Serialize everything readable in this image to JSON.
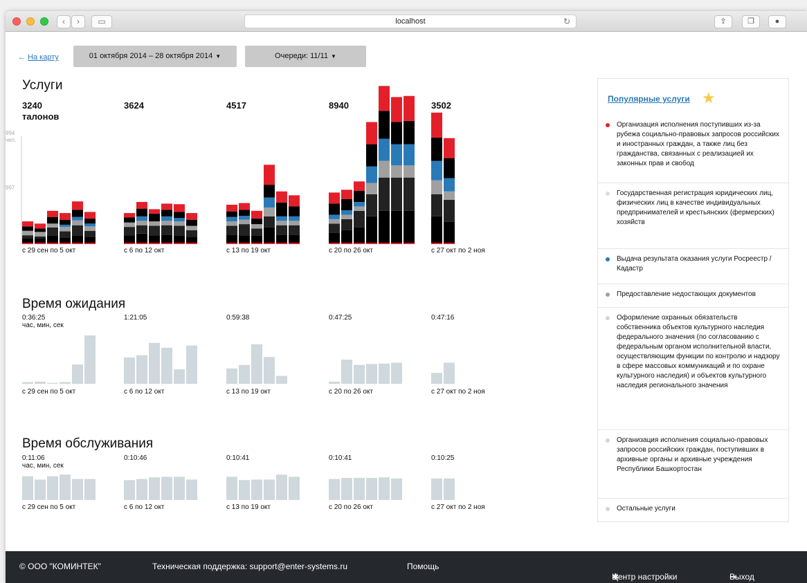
{
  "browser": {
    "url": "localhost"
  },
  "nav": {
    "back_label": "На карту",
    "date_range_label": "01 октября 2014 – 28 октября 2014",
    "queues_label": "Очереди: 11/11"
  },
  "services": {
    "title": "Услуги",
    "unit": "талонов",
    "axis_max_label": "994",
    "axis_unit_label": "чел.",
    "axis_mid_label": "997",
    "weeks": [
      {
        "label": "с 29 сен по 5 окт",
        "total": "3240"
      },
      {
        "label": "с 6 по 12 окт",
        "total": "3624"
      },
      {
        "label": "с 13 по 19 окт",
        "total": "4517"
      },
      {
        "label": "с 20 по 26 окт",
        "total": "8940"
      },
      {
        "label": "с 27 окт по 2 ноя",
        "total": "3502"
      }
    ]
  },
  "wait": {
    "title": "Время ожидания",
    "unit": "час, мин, сек",
    "weeks": [
      {
        "label": "с 29 сен по 5 окт",
        "value": "0:36:25"
      },
      {
        "label": "с 6 по 12 окт",
        "value": "1:21:05"
      },
      {
        "label": "с 13 по 19 окт",
        "value": "0:59:38"
      },
      {
        "label": "с 20 по 26 окт",
        "value": "0:47:25"
      },
      {
        "label": "с 27 окт по 2 ноя",
        "value": "0:47:16"
      }
    ]
  },
  "service_time": {
    "title": "Время обслуживания",
    "unit": "час, мин, сек",
    "weeks": [
      {
        "label": "с 29 сен по 5 окт",
        "value": "0:11:06"
      },
      {
        "label": "с 6 по 12 окт",
        "value": "0:10:46"
      },
      {
        "label": "с 13 по 19 окт",
        "value": "0:10:41"
      },
      {
        "label": "с 20 по 26 окт",
        "value": "0:10:41"
      },
      {
        "label": "с 27 окт по 2 ноя",
        "value": "0:10:25"
      }
    ]
  },
  "popular": {
    "title": "Популярные услуги",
    "items": [
      {
        "label": "Организация исполнения поступивших из-за рубежа социально-правовых запросов российских и иностранных граждан, а также лиц без гражданства, связанных с реализацией их законных прав и свобод",
        "color": "#e3202a"
      },
      {
        "label": "Государственная регистрация юридических лиц, физических лиц в качестве индивидуальных предпринимателей и крестьянских (фермерских) хозяйств",
        "color": "#d9dde0"
      },
      {
        "label": "Выдача результата оказания услуги Росреестр / Кадастр",
        "color": "#2a7ab8"
      },
      {
        "label": "Предоставление недостающих документов",
        "color": "#a0a0a0"
      },
      {
        "label": "Оформление охранных обязательств собственника объектов культурного наследия федерального значения (по согласованию с федеральным органом исполнительной власти, осуществляющим функции по контролю и надзору в сфере массовых коммуникаций и по охране культурного наследия) и объектов культурного наследия регионального значения",
        "color": "#cfd6d9"
      },
      {
        "label": "Организация исполнения социально-правовых запросов российских граждан, поступивших в архивные органы и архивные учреждения Республики Башкортостан",
        "color": "#cfd6d9"
      },
      {
        "label": "Остальные услуги",
        "color": "#cfd6d9"
      }
    ]
  },
  "footer": {
    "company": "© ООО \"КОМИНТЕК\"",
    "support": "Техническая поддержка: support@enter-systems.ru",
    "help": "Помощь",
    "settings": "Центр настройки",
    "logout": "Выход"
  },
  "chart_data": [
    {
      "type": "bar",
      "title": "Услуги",
      "stacked": true,
      "series_order": [
        "Остальные услуги",
        "Организация исполнения социально-правовых запросов",
        "Предоставление недостающих документов",
        "Выдача результата оказания услуги Росреестр / Кадастр",
        "Оформление охранных обязательств / Государственная регистрация",
        "Организация исполнения поступивших из-за рубежа запросов"
      ],
      "colors": [
        "#000000",
        "#222222",
        "#a0a0a0",
        "#2a7ab8",
        "#000000",
        "#e3202a"
      ],
      "categories": [
        "с 29 сен по 5 окт",
        "с 6 по 12 окт",
        "с 13 по 19 окт",
        "с 20 по 26 окт",
        "с 27 окт по 2 ноя"
      ],
      "ylim": [
        0,
        1994
      ],
      "days": [
        [
          [
            100,
            60,
            80,
            0,
            80,
            90
          ],
          [
            100,
            40,
            80,
            0,
            60,
            90
          ],
          [
            150,
            150,
            70,
            0,
            120,
            110
          ],
          [
            120,
            110,
            80,
            40,
            90,
            120
          ],
          [
            150,
            190,
            90,
            60,
            130,
            150
          ],
          [
            130,
            110,
            80,
            50,
            90,
            120
          ]
        ],
        [
          [
            160,
            150,
            80,
            0,
            90,
            80
          ],
          [
            190,
            150,
            80,
            80,
            140,
            120
          ],
          [
            160,
            170,
            80,
            0,
            140,
            80
          ],
          [
            170,
            170,
            80,
            80,
            120,
            110
          ],
          [
            150,
            180,
            80,
            60,
            110,
            140
          ],
          [
            130,
            120,
            80,
            0,
            110,
            120
          ]
        ],
        [
          [
            170,
            160,
            80,
            80,
            100,
            120
          ],
          [
            160,
            200,
            80,
            70,
            110,
            120
          ],
          [
            150,
            130,
            80,
            0,
            100,
            140
          ],
          [
            300,
            200,
            160,
            180,
            230,
            360
          ],
          [
            170,
            170,
            80,
            80,
            250,
            200
          ],
          [
            170,
            170,
            80,
            80,
            180,
            200
          ]
        ],
        [
          [
            200,
            170,
            80,
            80,
            200,
            200
          ],
          [
            250,
            200,
            80,
            80,
            200,
            170
          ],
          [
            300,
            300,
            80,
            80,
            200,
            170
          ],
          [
            500,
            400,
            200,
            300,
            400,
            400
          ],
          [
            600,
            600,
            300,
            400,
            500,
            450
          ],
          [
            600,
            600,
            220,
            380,
            400,
            450
          ],
          [
            600,
            600,
            220,
            380,
            420,
            450
          ]
        ],
        [
          [
            500,
            400,
            250,
            350,
            420,
            450
          ],
          [
            400,
            400,
            150,
            240,
            360,
            360
          ]
        ]
      ]
    },
    {
      "type": "bar",
      "title": "Время ожидания",
      "categories": [
        "с 29 сен по 5 окт",
        "с 6 по 12 окт",
        "с 13 по 19 окт",
        "с 20 по 26 окт",
        "с 27 окт по 2 ноя"
      ],
      "ylim": [
        0,
        110
      ],
      "days": [
        [
          4,
          5,
          2,
          4,
          44,
          110
        ],
        [
          60,
          65,
          93,
          82,
          33,
          87
        ],
        [
          35,
          43,
          90,
          61,
          18
        ],
        [
          5,
          55,
          43,
          45,
          46,
          48
        ],
        [
          25,
          48
        ]
      ]
    },
    {
      "type": "bar",
      "title": "Время обслуживания",
      "categories": [
        "с 29 сен по 5 окт",
        "с 6 по 12 окт",
        "с 13 по 19 окт",
        "с 20 по 26 окт",
        "с 27 окт по 2 ноя"
      ],
      "ylim": [
        0,
        50
      ],
      "days": [
        [
          43,
          37,
          43,
          46,
          38,
          38
        ],
        [
          36,
          38,
          41,
          42,
          42,
          37
        ],
        [
          42,
          36,
          37,
          37,
          46,
          42
        ],
        [
          38,
          40,
          40,
          40,
          41,
          39
        ],
        [
          39,
          39
        ]
      ]
    }
  ]
}
